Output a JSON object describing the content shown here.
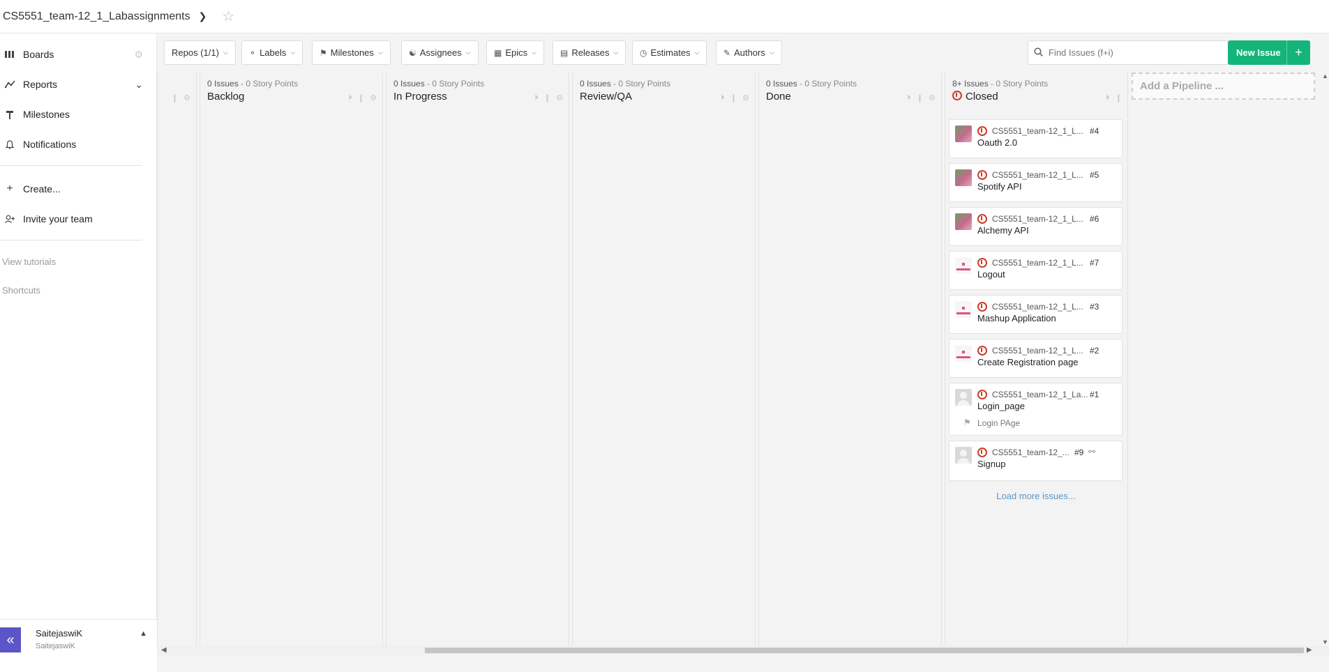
{
  "header": {
    "title": "CS5551_team-12_1_Labassignments"
  },
  "sidebar": {
    "items": [
      {
        "label": "Boards",
        "icon": "boards-icon"
      },
      {
        "label": "Reports",
        "icon": "reports-icon"
      },
      {
        "label": "Milestones",
        "icon": "milestones-icon"
      },
      {
        "label": "Notifications",
        "icon": "bell-icon"
      },
      {
        "label": "Create...",
        "icon": "plus-icon"
      },
      {
        "label": "Invite your team",
        "icon": "add-user-icon"
      }
    ],
    "links": [
      "View tutorials",
      "Shortcuts"
    ],
    "user": {
      "name": "SaitejaswiK",
      "username": "SaitejaswiK"
    }
  },
  "toolbar": {
    "filters": [
      {
        "label": "Repos (1/1)"
      },
      {
        "label": "Labels"
      },
      {
        "label": "Milestones"
      },
      {
        "label": "Assignees"
      },
      {
        "label": "Epics"
      },
      {
        "label": "Releases"
      },
      {
        "label": "Estimates"
      },
      {
        "label": "Authors"
      }
    ],
    "search_placeholder": "Find Issues (f+i)",
    "new_issue_label": "New Issue"
  },
  "pipelines": [
    {
      "count": "0 Issues",
      "points": "- 0 Story Points",
      "name": "Backlog"
    },
    {
      "count": "0 Issues",
      "points": "- 0 Story Points",
      "name": "In Progress"
    },
    {
      "count": "0 Issues",
      "points": "- 0 Story Points",
      "name": "Review/QA"
    },
    {
      "count": "0 Issues",
      "points": "- 0 Story Points",
      "name": "Done"
    },
    {
      "count": "8+ Issues",
      "points": "- 0 Story Points",
      "name": "Closed"
    }
  ],
  "closed_cards": [
    {
      "repo": "CS5551_team-12_1_L...",
      "num": "#4",
      "title": "Oauth 2.0",
      "avatar": "photo"
    },
    {
      "repo": "CS5551_team-12_1_L...",
      "num": "#5",
      "title": "Spotify API",
      "avatar": "photo"
    },
    {
      "repo": "CS5551_team-12_1_L...",
      "num": "#6",
      "title": "Alchemy API",
      "avatar": "photo"
    },
    {
      "repo": "CS5551_team-12_1_L...",
      "num": "#7",
      "title": "Logout",
      "avatar": "pink"
    },
    {
      "repo": "CS5551_team-12_1_L...",
      "num": "#3",
      "title": "Mashup Application",
      "avatar": "pink"
    },
    {
      "repo": "CS5551_team-12_1_L...",
      "num": "#2",
      "title": "Create Registration page",
      "avatar": "pink"
    },
    {
      "repo": "CS5551_team-12_1_La...",
      "num": "#1",
      "title": "Login_page",
      "milestone": "Login PAge",
      "avatar": "gray"
    },
    {
      "repo": "CS5551_team-12_...",
      "num": "#9",
      "title": "Signup",
      "avatar": "gray"
    }
  ],
  "load_more": "Load more issues...",
  "add_pipeline": "Add a Pipeline ...",
  "colors": {
    "accent": "#14b57a",
    "closed": "#cc3b2a",
    "collapse": "#5a56c8",
    "link": "#5b95c9"
  }
}
